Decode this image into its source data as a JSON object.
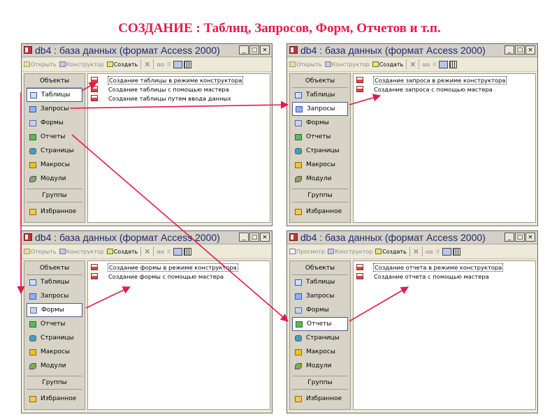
{
  "slide_title": "СОЗДАНИЕ :  Таблиц, Запросов,  Форм,  Отчетов  и т.п.",
  "colors": {
    "title": "#e6194b",
    "arrow": "#e6194b",
    "window_bg": "#ece9d8",
    "titlebar_text": "#1b2a6b"
  },
  "window_title": "db4 : база данных (формат Access 2000)",
  "window_buttons": [
    "_",
    "□",
    "×"
  ],
  "sidebar": {
    "header": "Объекты",
    "items": [
      {
        "label": "Таблицы",
        "icon": "table-icon"
      },
      {
        "label": "Запросы",
        "icon": "query-icon"
      },
      {
        "label": "Формы",
        "icon": "form-icon"
      },
      {
        "label": "Отчеты",
        "icon": "report-icon"
      },
      {
        "label": "Страницы",
        "icon": "page-icon"
      },
      {
        "label": "Макросы",
        "icon": "macro-icon"
      },
      {
        "label": "Модули",
        "icon": "module-icon"
      }
    ],
    "groups_header": "Группы",
    "favorites": "Избранное"
  },
  "toolbar": {
    "open": "Открыть",
    "preview": "Просмотр",
    "design": "Конструктор",
    "create": "Создать"
  },
  "windows": [
    {
      "selected": "Таблицы",
      "first_button": "open",
      "items": [
        "Создание таблицы в режиме конструктора",
        "Создание таблицы с помощью мастера",
        "Создание таблицы путем ввода данных"
      ]
    },
    {
      "selected": "Запросы",
      "first_button": "open",
      "items": [
        "Создание запроса в режиме конструктора",
        "Создание запроса с помощью мастера"
      ]
    },
    {
      "selected": "Формы",
      "first_button": "open",
      "items": [
        "Создание формы в режиме конструктора",
        "Создание формы с помощью мастера"
      ]
    },
    {
      "selected": "Отчеты",
      "first_button": "preview",
      "items": [
        "Создание отчета в режиме конструктора",
        "Создание отчета с помощью мастера"
      ]
    }
  ]
}
